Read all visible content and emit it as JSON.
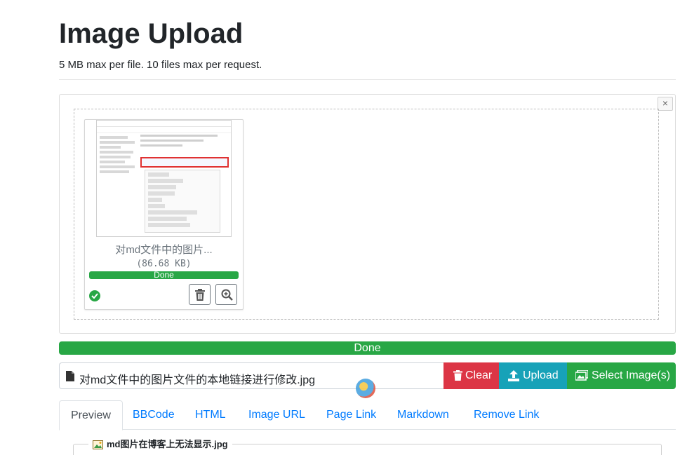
{
  "header": {
    "title": "Image Upload",
    "subtitle": "5 MB max per file. 10 files max per request."
  },
  "panel": {
    "close_label": "×",
    "file": {
      "name": "对md文件中的图片...",
      "size": "(86.68 KB)",
      "status": "Done",
      "progress": 1.0
    }
  },
  "overall": {
    "status": "Done",
    "progress": 1.0
  },
  "input_group": {
    "file_value": "对md文件中的图片文件的本地链接进行修改.jpg",
    "clear_label": "Clear",
    "upload_label": "Upload",
    "select_label": "Select Image(s)"
  },
  "tabs": [
    {
      "label": "Preview",
      "active": true
    },
    {
      "label": "BBCode"
    },
    {
      "label": "HTML"
    },
    {
      "label": "Image URL"
    },
    {
      "label": "Page Link"
    },
    {
      "label": "Markdown"
    },
    {
      "label": "Remove Link"
    }
  ],
  "result": {
    "legend": "md图片在博客上无法显示.jpg"
  },
  "colors": {
    "success": "#28a745",
    "danger": "#dc3545",
    "info": "#17a2b8",
    "link": "#007bff"
  },
  "icons": {
    "trash": "trash-icon",
    "zoom": "zoom-in-icon",
    "check": "check-circle-icon",
    "file": "file-icon",
    "upload": "upload-icon",
    "images": "images-icon"
  }
}
